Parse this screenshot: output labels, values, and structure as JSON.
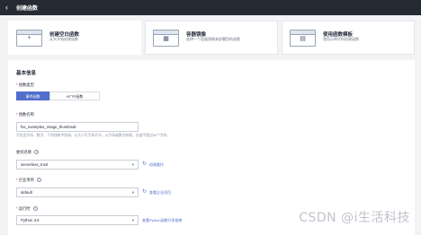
{
  "header": {
    "back_icon": "arrow-left-icon",
    "title": "创建函数"
  },
  "cards": [
    {
      "icon": "blank-function-icon",
      "title": "创建空白函数",
      "desc": "从头开始创建函数"
    },
    {
      "icon": "container-image-icon",
      "title": "容器镜像",
      "desc": "选择一个容器镜像来部署您的函数"
    },
    {
      "icon": "template-icon",
      "title": "使用函数模板",
      "desc": "使用示例代码创建函数"
    }
  ],
  "form": {
    "section_title": "基本信息",
    "type_label": "函数类型",
    "type_options": [
      "事件函数",
      "HTTP函数"
    ],
    "selected_type": "事件函数",
    "name_label": "函数名称",
    "name_value": "fss_examples_image_thumbnail",
    "name_hint": "可包含字母、数字、下划线和中划线，以大小写字母开头，以字母或数字结尾，长度不超过60个字符。",
    "agency_label": "委托名称",
    "agency_value": "serverless_trust",
    "agency_link": "创建委托",
    "project_label": "企业项目",
    "project_value": "default",
    "project_link": "查看企业项目",
    "runtime_label": "运行时",
    "runtime_value": "Python 3.6",
    "runtime_link": "查看Python函数开发指南"
  },
  "watermark": "CSDN @i生活科技",
  "colors": {
    "header_bg": "#252a33",
    "accent": "#526ecc",
    "required": "#e0302b"
  }
}
